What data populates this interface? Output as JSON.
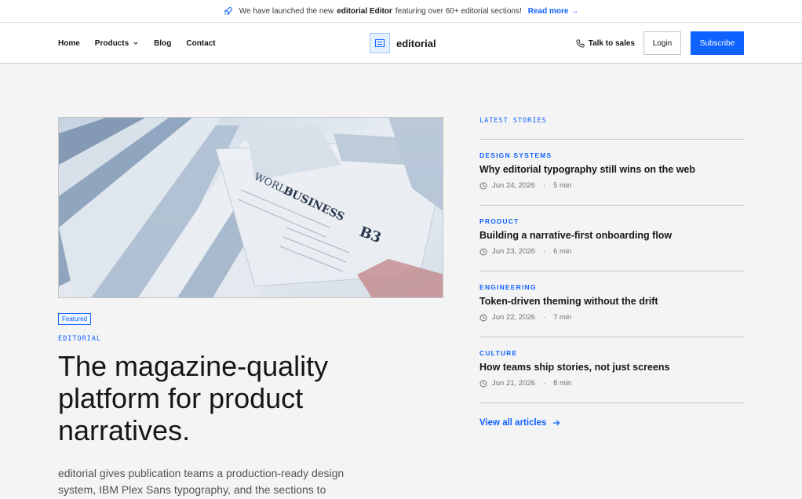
{
  "announcement": {
    "prefix": "We have launched the new",
    "highlight": "editorial Editor",
    "suffix": "featuring over 60+ editorial sections!",
    "link": "Read more →"
  },
  "nav": {
    "links": [
      "Home",
      "Products",
      "Blog",
      "Contact"
    ],
    "brand": "editorial",
    "sales": "Talk to sales",
    "login": "Login",
    "subscribe": "Subscribe"
  },
  "hero": {
    "badge": "Featured",
    "kicker": "EDITORIAL",
    "headline": "The magazine-quality platform for product narratives.",
    "lead": "editorial gives publication teams a production-ready design system, IBM Plex Sans typography, and the sections to",
    "image_text": {
      "world": "WORLD",
      "business": "BUSINESS",
      "page": "B3"
    }
  },
  "aside": {
    "label": "LATEST STORIES",
    "stories": [
      {
        "category": "DESIGN SYSTEMS",
        "title": "Why editorial typography still wins on the web",
        "date": "Jun 24, 2026",
        "read": "5 min"
      },
      {
        "category": "PRODUCT",
        "title": "Building a narrative-first onboarding flow",
        "date": "Jun 23, 2026",
        "read": "6 min"
      },
      {
        "category": "ENGINEERING",
        "title": "Token-driven theming without the drift",
        "date": "Jun 22, 2026",
        "read": "7 min"
      },
      {
        "category": "CULTURE",
        "title": "How teams ship stories, not just screens",
        "date": "Jun 21, 2026",
        "read": "8 min"
      }
    ],
    "view_all": "View all articles"
  },
  "colors": {
    "accent": "#0f62fe",
    "background": "#f4f4f4",
    "text": "#161616"
  }
}
